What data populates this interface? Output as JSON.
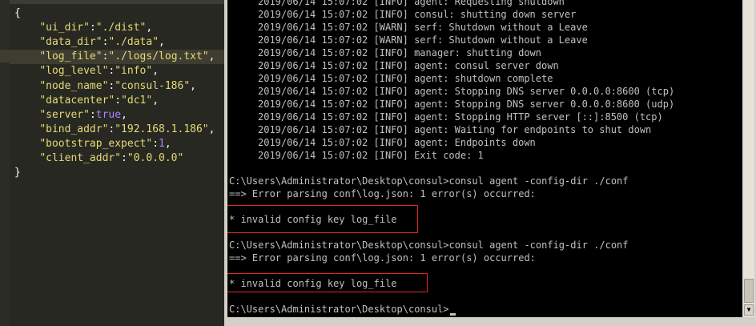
{
  "editor": {
    "lines": [
      {
        "open": "{"
      },
      {
        "key": "\"ui_dir\"",
        "sep": ":",
        "val": "\"./dist\"",
        "type": "s",
        "end": ","
      },
      {
        "key": "\"data_dir\"",
        "sep": ":",
        "val": "\"./data\"",
        "type": "s",
        "end": ","
      },
      {
        "key": "\"log_file\"",
        "sep": ":",
        "val": "\"./logs/log.txt\"",
        "type": "s",
        "end": ","
      },
      {
        "key": "\"log_level\"",
        "sep": ":",
        "val": "\"info\"",
        "type": "s",
        "end": ","
      },
      {
        "key": "\"node_name\"",
        "sep": ":",
        "val": "\"consul-186\"",
        "type": "s",
        "end": ","
      },
      {
        "key": "\"datacenter\"",
        "sep": ":",
        "val": "\"dc1\"",
        "type": "s",
        "end": ","
      },
      {
        "key": "\"server\"",
        "sep": ":",
        "val": "true",
        "type": "b",
        "end": ","
      },
      {
        "key": "\"bind_addr\"",
        "sep": ":",
        "val": "\"192.168.1.186\"",
        "type": "s",
        "end": ","
      },
      {
        "key": "\"bootstrap_expect\"",
        "sep": ":",
        "val": "1",
        "type": "n",
        "end": ","
      },
      {
        "key": "\"client_addr\"",
        "sep": ":",
        "val": "\"0.0.0.0\"",
        "type": "s",
        "end": ""
      },
      {
        "close": "}"
      }
    ]
  },
  "console": {
    "log_lines": [
      "2019/06/14 15:07:02 [INFO] agent: Requesting shutdown",
      "2019/06/14 15:07:02 [INFO] consul: shutting down server",
      "2019/06/14 15:07:02 [WARN] serf: Shutdown without a Leave",
      "2019/06/14 15:07:02 [WARN] serf: Shutdown without a Leave",
      "2019/06/14 15:07:02 [INFO] manager: shutting down",
      "2019/06/14 15:07:02 [INFO] agent: consul server down",
      "2019/06/14 15:07:02 [INFO] agent: shutdown complete",
      "2019/06/14 15:07:02 [INFO] agent: Stopping DNS server 0.0.0.0:8600 (tcp)",
      "2019/06/14 15:07:02 [INFO] agent: Stopping DNS server 0.0.0.0:8600 (udp)",
      "2019/06/14 15:07:02 [INFO] agent: Stopping HTTP server [::]:8500 (tcp)",
      "2019/06/14 15:07:02 [INFO] agent: Waiting for endpoints to shut down",
      "2019/06/14 15:07:02 [INFO] agent: Endpoints down",
      "2019/06/14 15:07:02 [INFO] Exit code: 1"
    ],
    "command_1": "C:\\Users\\Administrator\\Desktop\\consul>consul agent -config-dir ./conf",
    "error_1": "==> Error parsing conf\\log.json: 1 error(s) occurred:",
    "detail_1": "* invalid config key log_file",
    "command_2": "C:\\Users\\Administrator\\Desktop\\consul>consul agent -config-dir ./conf",
    "error_2": "==> Error parsing conf\\log.json: 1 error(s) occurred:",
    "detail_2": "* invalid config key log_file",
    "prompt": "C:\\Users\\Administrator\\Desktop\\consul>",
    "highlight_color": "#e0262b"
  }
}
